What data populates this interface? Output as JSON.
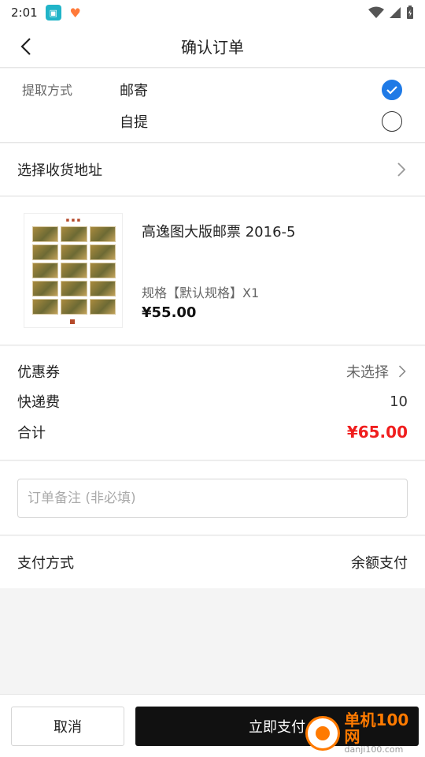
{
  "status_bar": {
    "time": "2:01"
  },
  "header": {
    "title": "确认订单"
  },
  "pickup": {
    "label": "提取方式",
    "options": [
      {
        "label": "邮寄",
        "selected": true
      },
      {
        "label": "自提",
        "selected": false
      }
    ]
  },
  "address": {
    "label": "选择收货地址"
  },
  "product": {
    "name": "高逸图大版邮票 2016-5",
    "spec": "规格【默认规格】X1",
    "price": "¥55.00"
  },
  "fees": {
    "coupon_label": "优惠券",
    "coupon_value": "未选择",
    "shipping_label": "快递费",
    "shipping_value": "10",
    "total_label": "合计",
    "total_value": "¥65.00",
    "total_color": "#f01d1d"
  },
  "remark": {
    "placeholder": "订单备注 (非必填)",
    "value": ""
  },
  "payment": {
    "label": "支付方式",
    "value": "余额支付"
  },
  "actions": {
    "cancel": "取消",
    "pay": "立即支付"
  },
  "watermark": {
    "name": "单机100网",
    "url": "danji100.com"
  }
}
